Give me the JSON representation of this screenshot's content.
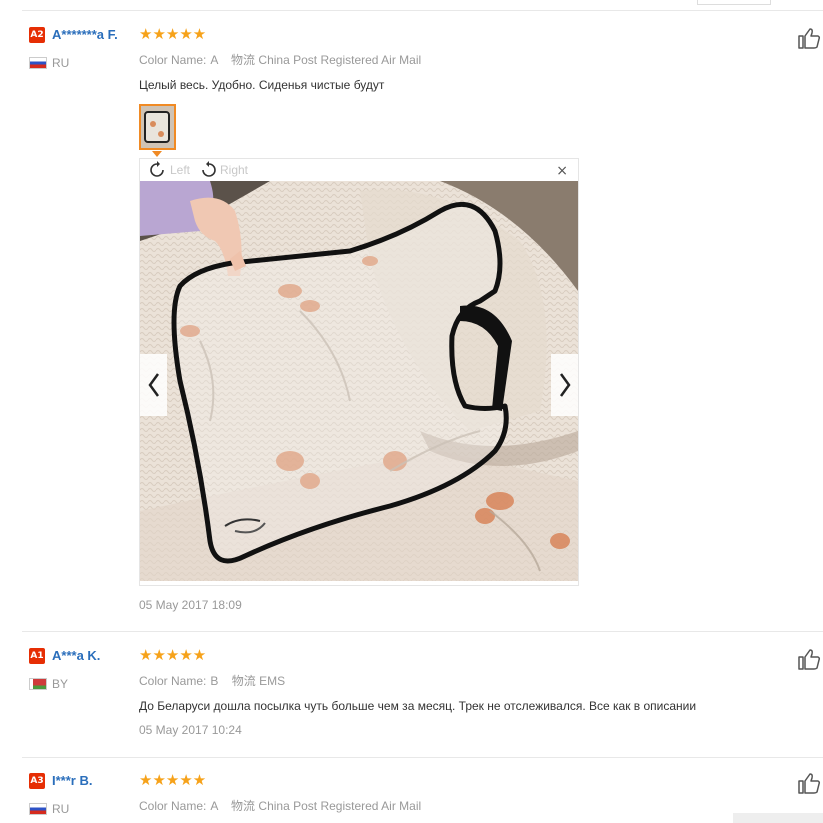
{
  "reviews": [
    {
      "badge": "A2",
      "user": "A*******a F.",
      "country": "RU",
      "stars": "★★★★★",
      "color_label": "Color Name:",
      "color_value": "A",
      "ship_label": "物流",
      "ship_value": "China Post Registered Air Mail",
      "text": "Целый весь. Удобно. Сиденья чистые будут",
      "date": "05 May 2017 18:09"
    },
    {
      "badge": "A1",
      "user": "A***a K.",
      "country": "BY",
      "stars": "★★★★★",
      "color_label": "Color Name:",
      "color_value": "B",
      "ship_label": "物流",
      "ship_value": "EMS",
      "text": "До Беларуси дошла посылка чуть больше чем за месяц. Трек не отслеживался. Все как в описании",
      "date": "05 May 2017 10:24"
    },
    {
      "badge": "A3",
      "user": "I***r B.",
      "country": "RU",
      "stars": "★★★★★",
      "color_label": "Color Name:",
      "color_value": "A",
      "ship_label": "物流",
      "ship_value": "China Post Registered Air Mail"
    }
  ],
  "viewer": {
    "rotate_left": "Left",
    "rotate_right": "Right",
    "close": "×"
  },
  "icons": {
    "like": "thumbs-up-icon",
    "rotate_left": "rotate-left-icon",
    "rotate_right": "rotate-right-icon",
    "prev": "chevron-left-icon",
    "next": "chevron-right-icon"
  },
  "colors": {
    "username": "#2a6ebb",
    "badge": "#e62e04",
    "stars": "#f6a21a",
    "muted": "#999999",
    "thumb_border": "#f08a24"
  }
}
